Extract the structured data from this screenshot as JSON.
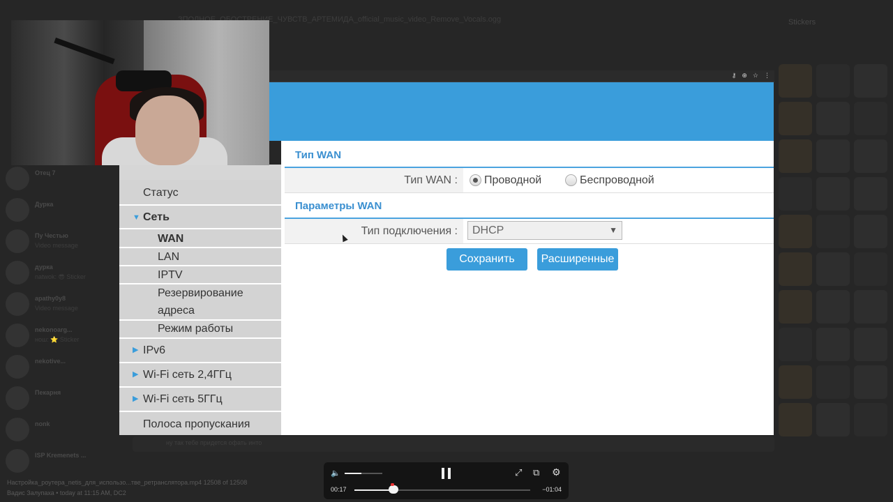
{
  "background": {
    "top_title": "ЗПОЛНОЕ_ОБОСТРЕНИЕ_ЧУВСТВ_АРТЕМИДА_official_music_video_Remove_Vocals.ogg",
    "stickers_label": "Stickers",
    "chats": [
      {
        "name": "Отец 7",
        "sub": ""
      },
      {
        "name": "Дурка",
        "sub": ""
      },
      {
        "name": "Пу Честью",
        "sub": "Video message"
      },
      {
        "name": "дурка",
        "sub": "natwok: 😎 Sticker"
      },
      {
        "name": "apathy0y8",
        "sub": "Video message"
      },
      {
        "name": "nekonoarg...",
        "sub": "нош: ⭐ Sticker"
      },
      {
        "name": "nekotive...",
        "sub": ""
      },
      {
        "name": "Пекарня",
        "sub": ""
      },
      {
        "name": "nonk",
        "sub": ""
      },
      {
        "name": "ISP Kremenets ...",
        "sub": ""
      }
    ],
    "message_hint": "ну так тебе придется офать инто",
    "file_name": "Настройка_роутера_netis_для_использо...тве_ретранслятора.mp4 12508 of 12508",
    "author_line": "Вадис Залупаха • today at 11:15 AM, DC2"
  },
  "browser": {
    "icons": [
      "key-icon",
      "zoom-icon",
      "star-icon",
      "menu-icon"
    ]
  },
  "nav": {
    "status": "Статус",
    "network": "Сеть",
    "sub": {
      "wan": "WAN",
      "lan": "LAN",
      "iptv": "IPTV",
      "reservation_1": "Резервирование",
      "reservation_2": "адреса",
      "mode": "Режим работы"
    },
    "ipv6": "IPv6",
    "wifi24": "Wi-Fi сеть 2,4ГГц",
    "wifi5": "Wi-Fi сеть 5ГГц",
    "bandwidth": "Полоса пропускания"
  },
  "content": {
    "section_wan_type": "Тип WAN",
    "wan_type_label": "Тип WAN :",
    "radio_wired": "Проводной",
    "radio_wireless": "Беспроводной",
    "section_wan_params": "Параметры WAN",
    "connection_type_label": "Тип подключения :",
    "connection_type_value": "DHCP",
    "save_button": "Сохранить",
    "advanced_button": "Расширенные"
  },
  "player": {
    "time_current": "00:17",
    "time_remaining": "−01:04",
    "volume_fraction": 0.45,
    "progress_fraction": 0.21
  },
  "colors": {
    "router_blue": "#3a9ddb",
    "section_title": "#3a8fd0"
  }
}
